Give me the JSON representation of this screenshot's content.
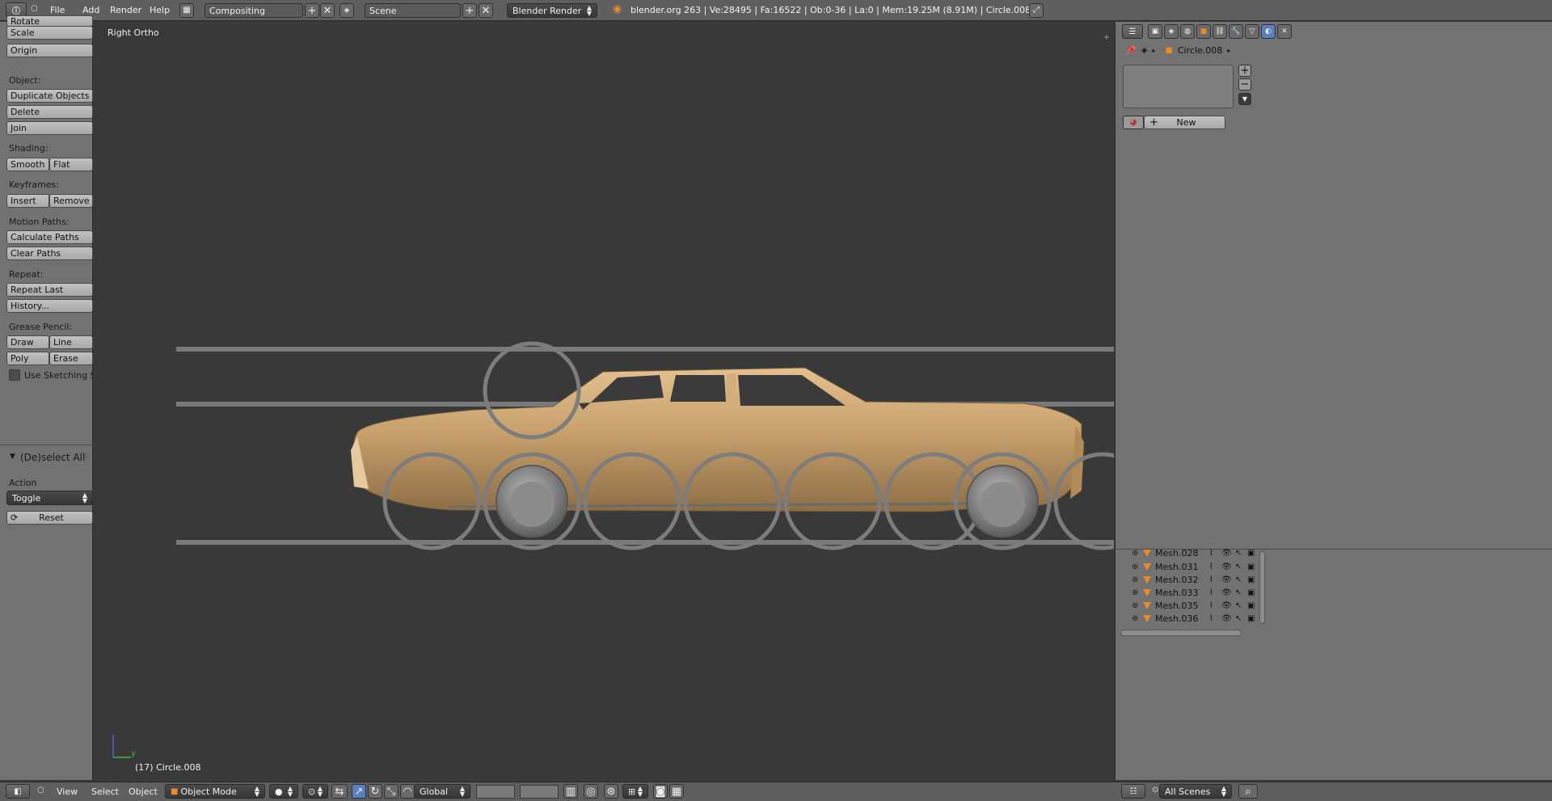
{
  "topbar": {
    "menus": [
      "File",
      "Add",
      "Render",
      "Help"
    ],
    "layout_name": "Compositing",
    "scene_name": "Scene",
    "render_engine": "Blender Render",
    "stats": "blender.org 263 | Ve:28495 | Fa:16522 | Ob:0-36 | La:0 | Mem:19.25M (8.91M) | Circle.008"
  },
  "toolshelf": {
    "rotate": "Rotate",
    "scale": "Scale",
    "origin": "Origin",
    "object_label": "Object:",
    "duplicate": "Duplicate Objects",
    "delete": "Delete",
    "join": "Join",
    "shading_label": "Shading:",
    "smooth": "Smooth",
    "flat": "Flat",
    "keyframes_label": "Keyframes:",
    "insert": "Insert",
    "remove": "Remove",
    "motion_label": "Motion Paths:",
    "calc_paths": "Calculate Paths",
    "clear_paths": "Clear Paths",
    "repeat_label": "Repeat:",
    "repeat_last": "Repeat Last",
    "history": "History...",
    "grease_label": "Grease Pencil:",
    "draw": "Draw",
    "line": "Line",
    "poly": "Poly",
    "erase": "Erase",
    "sketching": "Use Sketching Se",
    "operator_title": "(De)select All",
    "action_label": "Action",
    "action_value": "Toggle",
    "reset": "Reset"
  },
  "viewport": {
    "view_name": "Right Ortho",
    "object_info": "(17) Circle.008",
    "axis_y": "y"
  },
  "properties": {
    "breadcrumb_object": "Circle.008",
    "new_button": "New"
  },
  "outliner": {
    "rows": [
      {
        "name": "Mesh.028"
      },
      {
        "name": "Mesh.031"
      },
      {
        "name": "Mesh.032"
      },
      {
        "name": "Mesh.033"
      },
      {
        "name": "Mesh.035"
      },
      {
        "name": "Mesh.036"
      }
    ],
    "scene_filter": "All Scenes"
  },
  "bottombar": {
    "menus": [
      "View",
      "Select",
      "Object"
    ],
    "mode": "Object Mode",
    "orientation": "Global"
  },
  "colors": {
    "viewport_bg": "#393939",
    "panel_bg": "#727272",
    "header_bg": "#5f5f5f",
    "car_body": "#c9a06a",
    "wheel_ring": "#7d7d7d",
    "accent_orange": "#e8892a"
  }
}
